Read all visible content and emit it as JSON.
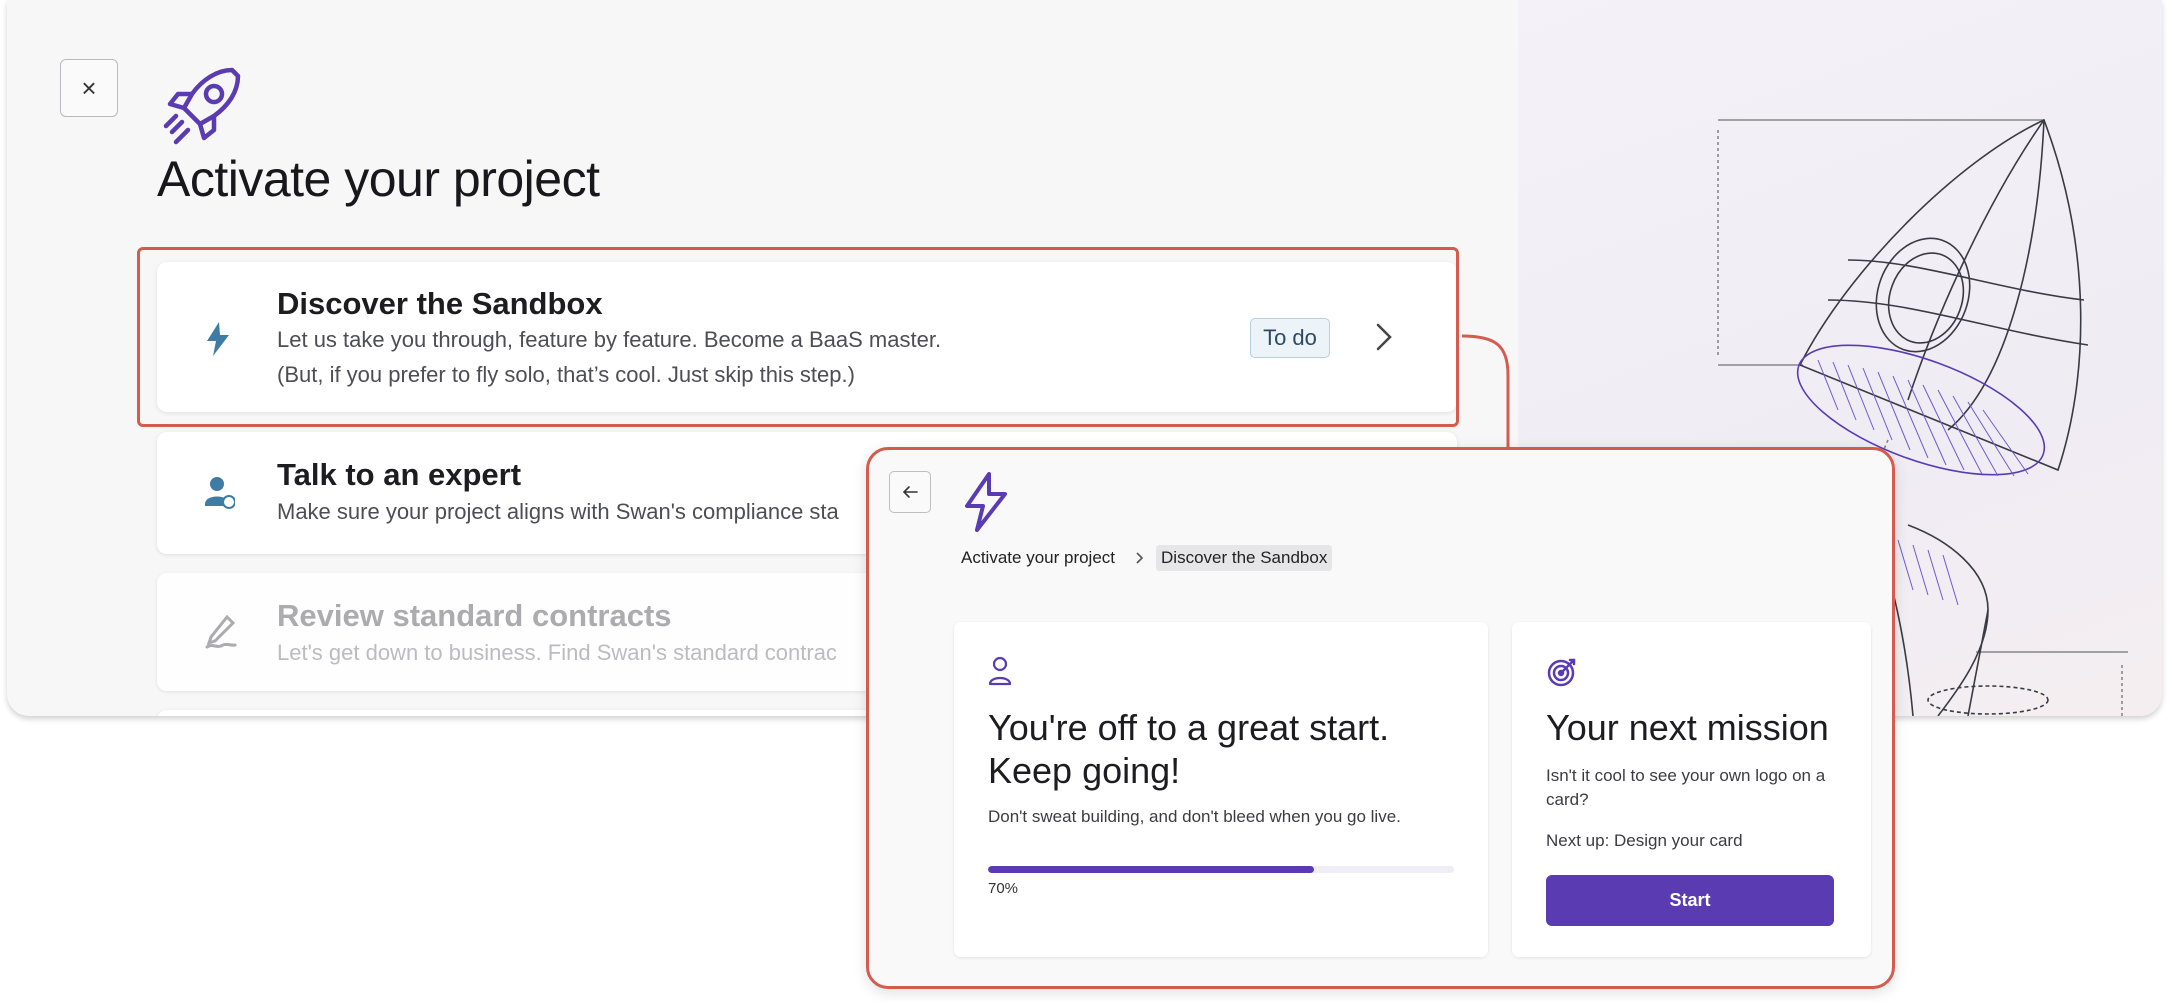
{
  "window": {
    "title": "Activate your project",
    "close_label": "×"
  },
  "steps": [
    {
      "title": "Discover the Sandbox",
      "desc_line1": "Let us take you through, feature by feature. Become a BaaS master.",
      "desc_line2": "(But, if you prefer to fly solo, that’s cool. Just skip this step.)",
      "badge": "To do",
      "icon": "bolt-icon"
    },
    {
      "title": "Talk to an expert",
      "desc_line1": "Make sure your project aligns with Swan's compliance sta",
      "icon": "person-chat-icon"
    },
    {
      "title": "Review standard contracts",
      "desc_line1": "Let's get down to business. Find Swan's standard contrac",
      "icon": "signature-icon"
    }
  ],
  "popup": {
    "breadcrumb": [
      "Activate your project",
      "Discover the Sandbox"
    ],
    "progress_card": {
      "heading_line1": "You're off to a great start.",
      "heading_line2": "Keep going!",
      "text": "Don't sweat building, and don't bleed when you go live.",
      "progress": 0.7,
      "progress_label": "70%",
      "icon": "user-icon"
    },
    "mission_card": {
      "heading": "Your next mission",
      "text_line1": "Isn't it cool to see your own logo on a",
      "text_line2": "card?",
      "next_up": "Next up: Design your card",
      "button": "Start",
      "icon": "target-icon"
    }
  },
  "colors": {
    "accent": "#5a3bb2",
    "highlight": "#d45b4e",
    "step_icon": "#3f7ca4"
  }
}
